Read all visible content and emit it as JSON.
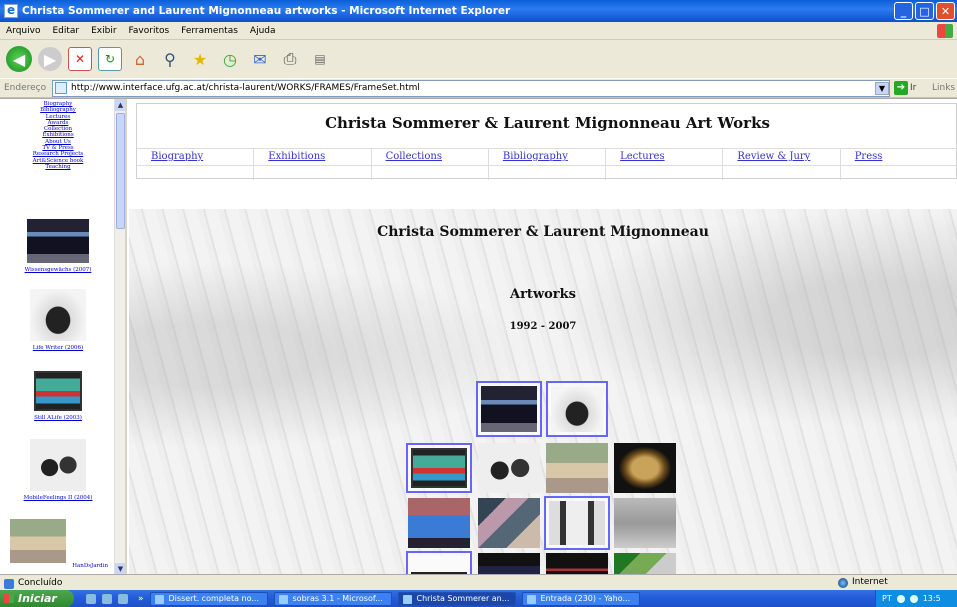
{
  "window": {
    "title": "Christa Sommerer and Laurent Mignonneau artworks - Microsoft Internet Explorer",
    "btn_min": "_",
    "btn_max": "□",
    "btn_close": "✕"
  },
  "menu": [
    "Arquivo",
    "Editar",
    "Exibir",
    "Favoritos",
    "Ferramentas",
    "Ajuda"
  ],
  "toolbar_icons": [
    "back-icon",
    "forward-icon",
    "stop-icon",
    "refresh-icon",
    "home-icon",
    "search-icon",
    "favorites-icon",
    "history-icon",
    "mail-icon",
    "print-icon",
    "edit-icon"
  ],
  "address": {
    "label": "Endereço",
    "url": "http://www.interface.ufg.ac.at/christa-laurent/WORKS/FRAMES/FrameSet.html",
    "go": "Ir",
    "links": "Links"
  },
  "left_nav": {
    "links": [
      "Biography",
      "Bibliography",
      "Lectures",
      "Awards",
      "Collection",
      "Exhibitions",
      "About Us",
      "TV & Press",
      "Research Projects",
      "Art&Science book",
      "Teaching"
    ],
    "works": [
      "Wissensgewächs (2007)",
      "Life Writer (2006)",
      "Still ALife (2003)",
      "MobileFeelings II (2004)",
      "HanDsJardin"
    ]
  },
  "header": {
    "title": "Christa Sommerer & Laurent Mignonneau Art Works",
    "nav": [
      "Biography",
      "Exhibitions",
      "Collections",
      "Bibliography",
      "Lectures",
      "Review & Jury",
      "Press"
    ]
  },
  "main": {
    "title": "Christa Sommerer & Laurent Mignonneau",
    "subtitle": "Artworks",
    "years": "1992 - 2007"
  },
  "status": {
    "text": "Concluído",
    "zone": "Internet"
  },
  "taskbar": {
    "start": "Iniciar",
    "more": "»",
    "tasks": [
      "Dissert. completa no...",
      "sobras 3.1 - Microsof...",
      "Christa Sommerer an...",
      "Entrada (230) - Yaho..."
    ],
    "lang": "PT",
    "clock": "13:5"
  }
}
